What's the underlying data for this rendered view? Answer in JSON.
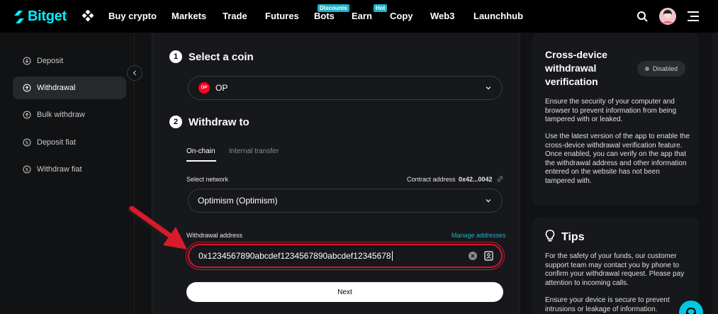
{
  "nav": {
    "logo_text": "Bitget",
    "items": [
      {
        "label": "Buy crypto"
      },
      {
        "label": "Markets"
      },
      {
        "label": "Trade"
      },
      {
        "label": "Futures"
      },
      {
        "label": "Bots",
        "badge": "Discounts"
      },
      {
        "label": "Earn",
        "badge": "Hot"
      },
      {
        "label": "Copy"
      },
      {
        "label": "Web3"
      },
      {
        "label": "Launchhub"
      }
    ],
    "right_icons": [
      "search-icon",
      "avatar",
      "menu-icon"
    ]
  },
  "sidebar": {
    "items": [
      {
        "label": "Deposit",
        "icon": "deposit-icon"
      },
      {
        "label": "Withdrawal",
        "icon": "withdrawal-icon",
        "active": true
      },
      {
        "label": "Bulk withdraw",
        "icon": "bulk-withdraw-icon"
      },
      {
        "label": "Deposit fiat",
        "icon": "deposit-fiat-icon"
      },
      {
        "label": "Withdraw fiat",
        "icon": "withdraw-fiat-icon"
      }
    ]
  },
  "withdraw": {
    "step1": {
      "num": "1",
      "title": "Select a coin",
      "coin_icon_text": "OP",
      "coin": "OP"
    },
    "step2": {
      "num": "2",
      "title": "Withdraw to"
    },
    "tabs": {
      "active": "On-chain",
      "other": "Internal transfer"
    },
    "network": {
      "label": "Select network",
      "contract_label": "Contract address",
      "contract_value": "0x42...0042",
      "value": "Optimism (Optimism)"
    },
    "address": {
      "label": "Withdrawal address",
      "manage_link": "Manage addresses",
      "value": "0x1234567890abcdef1234567890abcdef12345678"
    },
    "next_label": "Next"
  },
  "verification": {
    "title_lines": [
      "Cross-device",
      "withdrawal",
      "verification"
    ],
    "status": "Disabled",
    "para1": "Ensure the security of your computer and browser to prevent information from being tampered with or leaked.",
    "para2": "Use the latest version of the app to enable the cross-device withdrawal verification feature. Once enabled, you can verify on the app that the withdrawal address and other information entered on the website has not been tampered with."
  },
  "tips": {
    "title": "Tips",
    "para1": "For the safety of your funds, our customer support team may contact you by phone to confirm your withdrawal request. Please pay attention to incoming calls.",
    "para2": "Ensure your device is secure to prevent intrusions or leakage of information."
  },
  "colors": {
    "brand": "#00f0ff",
    "highlight": "#d0172f",
    "badge": "#1fb1c9",
    "link": "#1fb1c9",
    "op_coin": "#ff0420"
  }
}
